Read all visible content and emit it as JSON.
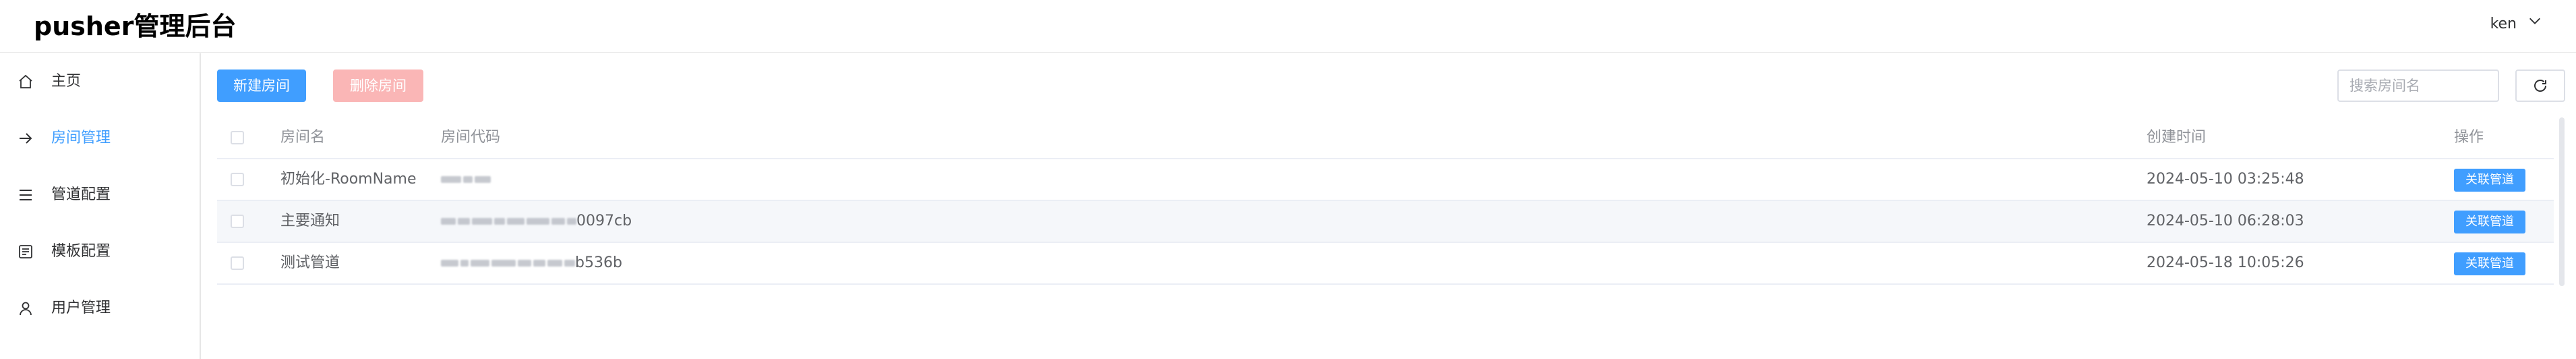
{
  "header": {
    "title": "pusher管理后台",
    "user": "ken"
  },
  "sidebar": {
    "items": [
      {
        "label": "主页",
        "icon": "home-icon"
      },
      {
        "label": "房间管理",
        "icon": "arrow-right-icon",
        "active": true
      },
      {
        "label": "管道配置",
        "icon": "list-icon"
      },
      {
        "label": "模板配置",
        "icon": "template-icon"
      },
      {
        "label": "用户管理",
        "icon": "user-icon"
      }
    ]
  },
  "toolbar": {
    "new_label": "新建房间",
    "delete_label": "删除房间",
    "search_placeholder": "搜索房间名"
  },
  "table": {
    "headers": [
      "房间名",
      "房间代码",
      "创建时间",
      "操作"
    ],
    "rows": [
      {
        "name": "初始化-RoomName",
        "code_suffix": "",
        "created": "2024-05-10 03:25:48",
        "action": "关联管道"
      },
      {
        "name": "主要通知",
        "code_suffix": "0097cb",
        "created": "2024-05-10 06:28:03",
        "action": "关联管道"
      },
      {
        "name": "测试管道",
        "code_suffix": "b536b",
        "created": "2024-05-18 10:05:26",
        "action": "关联管道"
      }
    ]
  },
  "colors": {
    "primary": "#409eff",
    "danger_disabled": "#fab6b6",
    "stripe": "#f5f7fa"
  }
}
